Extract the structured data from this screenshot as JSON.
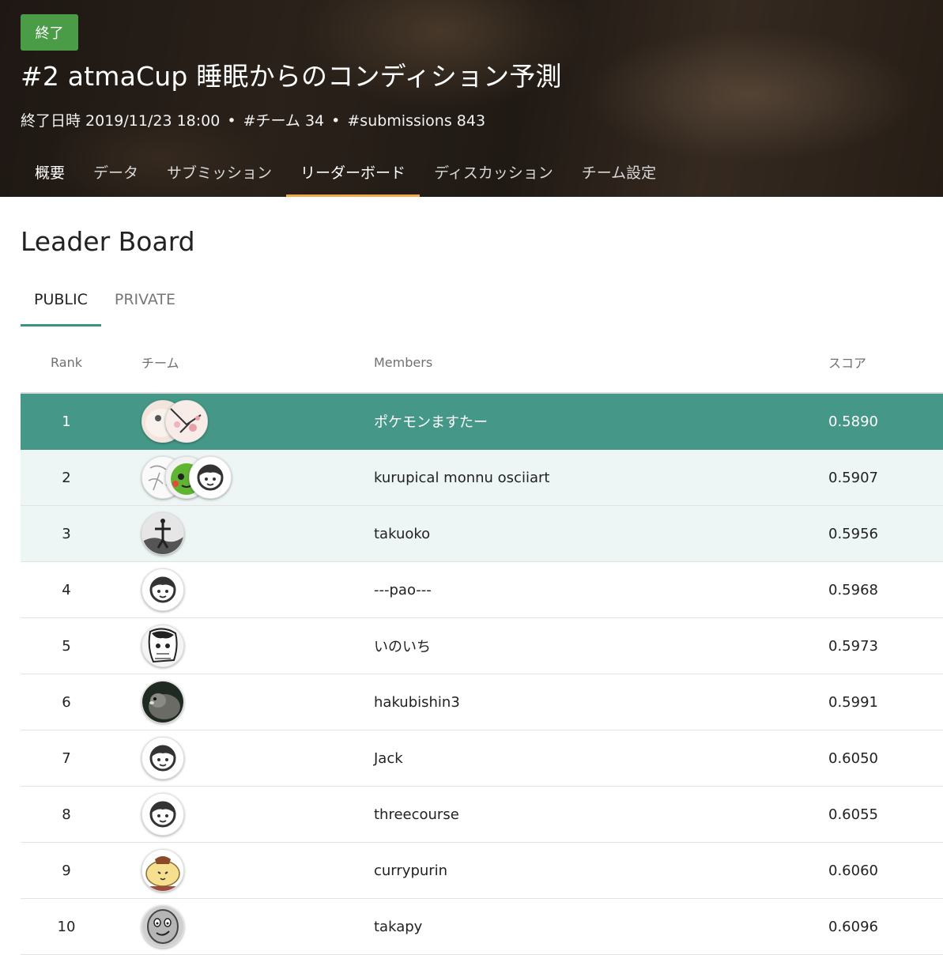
{
  "status_badge": "終了",
  "title": "#2 atmaCup 睡眠からのコンディション予測",
  "meta": {
    "end_date": "終了日時 2019/11/23 18:00",
    "teams": "#チーム 34",
    "submissions": "#submissions 843",
    "separator": "•"
  },
  "nav_tabs": [
    "概要",
    "データ",
    "サブミッション",
    "リーダーボード",
    "ディスカッション",
    "チーム設定"
  ],
  "active_nav_tab": "リーダーボード",
  "leaderboard_title": "Leader Board",
  "sub_tabs": [
    "PUBLIC",
    "PRIVATE"
  ],
  "active_sub_tab": "PUBLIC",
  "table": {
    "headers": {
      "rank": "Rank",
      "team": "チーム",
      "members": "Members",
      "score": "スコア"
    },
    "rows": [
      {
        "rank": "1",
        "members": "ポケモンますたー",
        "score": "0.5890",
        "avatars": [
          "pink-doodle-avatar",
          "cherry-blossom-avatar"
        ]
      },
      {
        "rank": "2",
        "members": "kurupical monnu osciiart",
        "score": "0.5907",
        "avatars": [
          "sketch-avatar",
          "green-character-avatar",
          "default-face-avatar"
        ]
      },
      {
        "rank": "3",
        "members": "takuoko",
        "score": "0.5956",
        "avatars": [
          "monochrome-photo-avatar"
        ]
      },
      {
        "rank": "4",
        "members": "---pao---",
        "score": "0.5968",
        "avatars": [
          "default-face-avatar"
        ]
      },
      {
        "rank": "5",
        "members": "いのいち",
        "score": "0.5973",
        "avatars": [
          "manga-avatar"
        ]
      },
      {
        "rank": "6",
        "members": "hakubishin3",
        "score": "0.5991",
        "avatars": [
          "animal-photo-avatar"
        ]
      },
      {
        "rank": "7",
        "members": "Jack",
        "score": "0.6050",
        "avatars": [
          "default-face-avatar"
        ]
      },
      {
        "rank": "8",
        "members": "threecourse",
        "score": "0.6055",
        "avatars": [
          "default-face-avatar"
        ]
      },
      {
        "rank": "9",
        "members": "currypurin",
        "score": "0.6060",
        "avatars": [
          "pompompurin-avatar"
        ]
      },
      {
        "rank": "10",
        "members": "takapy",
        "score": "0.6096",
        "avatars": [
          "gray-face-avatar"
        ]
      }
    ]
  },
  "colors": {
    "badge": "#4b9c46",
    "nav_active_underline": "#f0a94a",
    "subtab_active_underline": "#3a9382",
    "rank1_row": "#459887",
    "highlight_row": "#edf6f4"
  }
}
